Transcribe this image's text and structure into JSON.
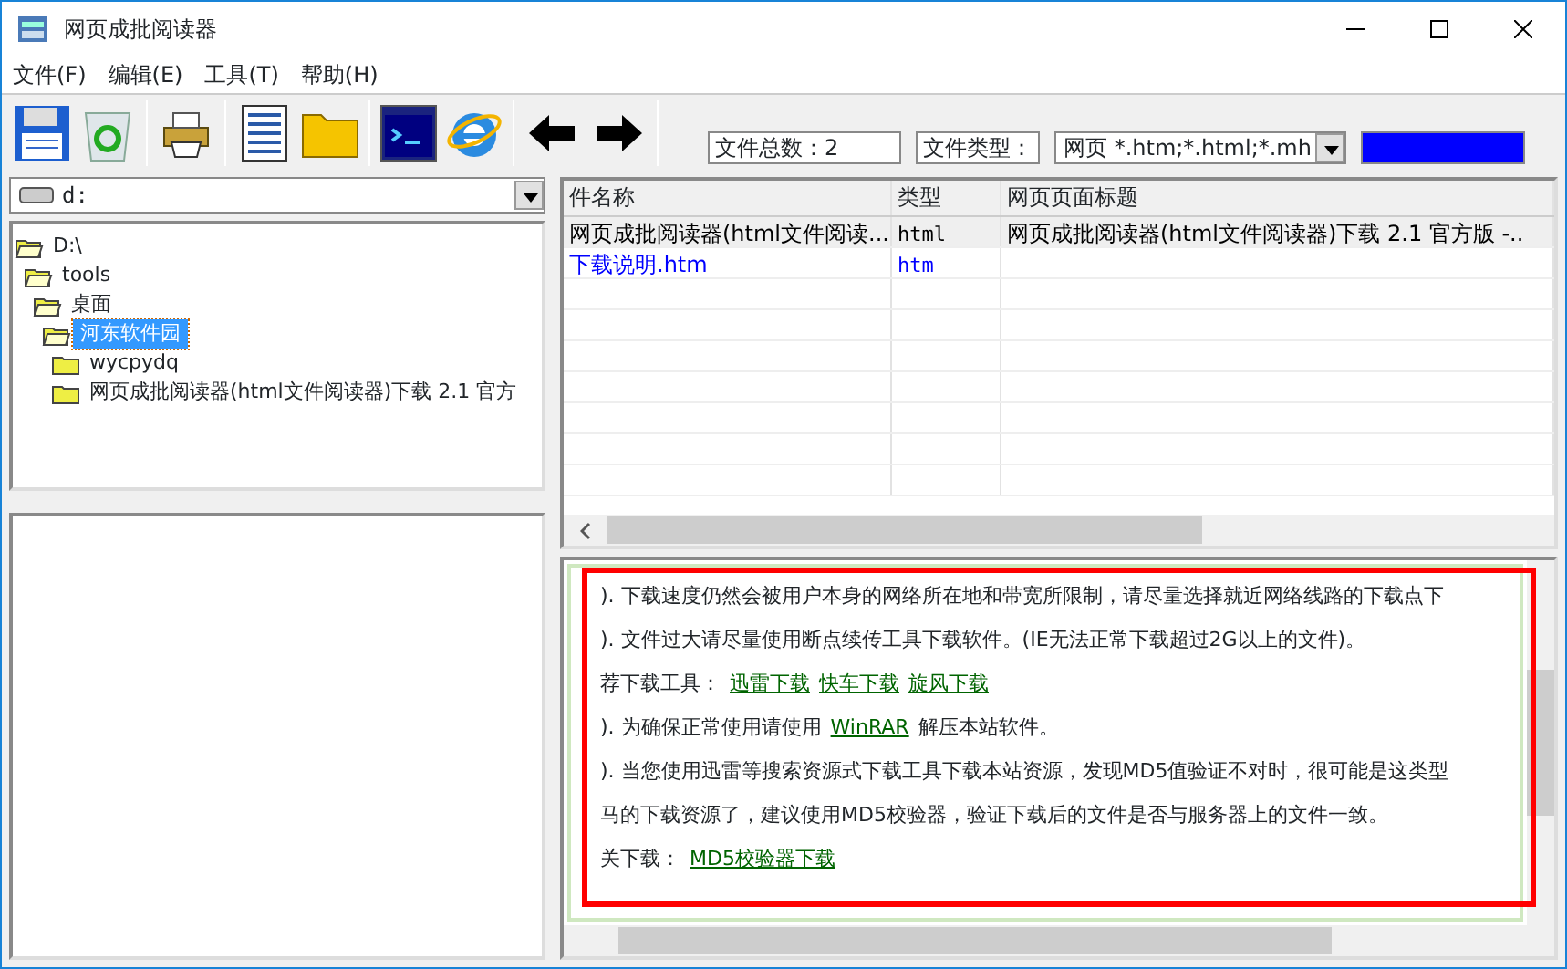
{
  "window": {
    "title": "网页成批阅读器"
  },
  "menu": [
    "文件(F)",
    "编辑(E)",
    "工具(T)",
    "帮助(H)"
  ],
  "toolbar": {
    "file_count": "文件总数：2",
    "file_type_label": "文件类型：",
    "file_type_value": "网页  *.htm;*.html;*.mh",
    "progress": {
      "level": 1
    }
  },
  "drive": {
    "value": "d:"
  },
  "tree": [
    {
      "label": "D:\\",
      "selected": false,
      "expanded": true,
      "children": [
        {
          "label": "tools",
          "selected": false,
          "expanded": true,
          "children": [
            {
              "label": "桌面",
              "selected": false,
              "expanded": true,
              "children": [
                {
                  "label": "河东软件园",
                  "selected": true,
                  "expanded": true,
                  "children": [
                    {
                      "label": "wycpydq",
                      "selected": false,
                      "expanded": false
                    },
                    {
                      "label": "网页成批阅读器(html文件阅读器)下载 2.1 官方",
                      "selected": false,
                      "expanded": false
                    }
                  ]
                }
              ]
            }
          ]
        }
      ]
    }
  ],
  "file_list": {
    "columns": [
      "件名称",
      "类型",
      "网页页面标题"
    ],
    "rows": [
      {
        "cells": [
          "网页成批阅读器(html文件阅读...",
          "html",
          "网页成批阅读器(html文件阅读器)下载 2.1 官方版 -.."
        ],
        "selected": true,
        "color": "#000000"
      },
      {
        "cells": [
          "下载说明.htm",
          "htm",
          ""
        ],
        "selected": false,
        "color": "#0000ff"
      }
    ]
  },
  "preview": {
    "lines": [
      {
        "parts": [
          {
            "kind": "text",
            "text": "). 下载速度仍然会被用户本身的网络所在地和带宽所限制，请尽量选择就近网络线路的下载点下"
          }
        ]
      },
      {
        "parts": [
          {
            "kind": "text",
            "text": "). 文件过大请尽量使用断点续传工具下载软件。(IE无法正常下载超过2G以上的文件)。"
          }
        ]
      },
      {
        "parts": [
          {
            "kind": "text",
            "text": "荐下载工具："
          },
          {
            "kind": "link",
            "text": "迅雷下载"
          },
          {
            "kind": "link",
            "text": "快车下载"
          },
          {
            "kind": "link",
            "text": "旋风下载"
          }
        ]
      },
      {
        "parts": [
          {
            "kind": "text",
            "text": "). 为确保正常使用请使用"
          },
          {
            "kind": "link",
            "text": "WinRAR"
          },
          {
            "kind": "text",
            "text": "解压本站软件。"
          }
        ]
      },
      {
        "parts": [
          {
            "kind": "text",
            "text": "). 当您使用迅雷等搜索资源式下载工具下载本站资源，发现MD5值验证不对时，很可能是这类型"
          }
        ]
      },
      {
        "parts": [
          {
            "kind": "text",
            "text": "马的下载资源了，建议使用MD5校验器，验证下载后的文件是否与服务器上的文件一致。"
          }
        ]
      },
      {
        "parts": [
          {
            "kind": "text",
            "text": "关下载："
          },
          {
            "kind": "link",
            "text": "MD5校验器下载"
          }
        ]
      }
    ]
  }
}
